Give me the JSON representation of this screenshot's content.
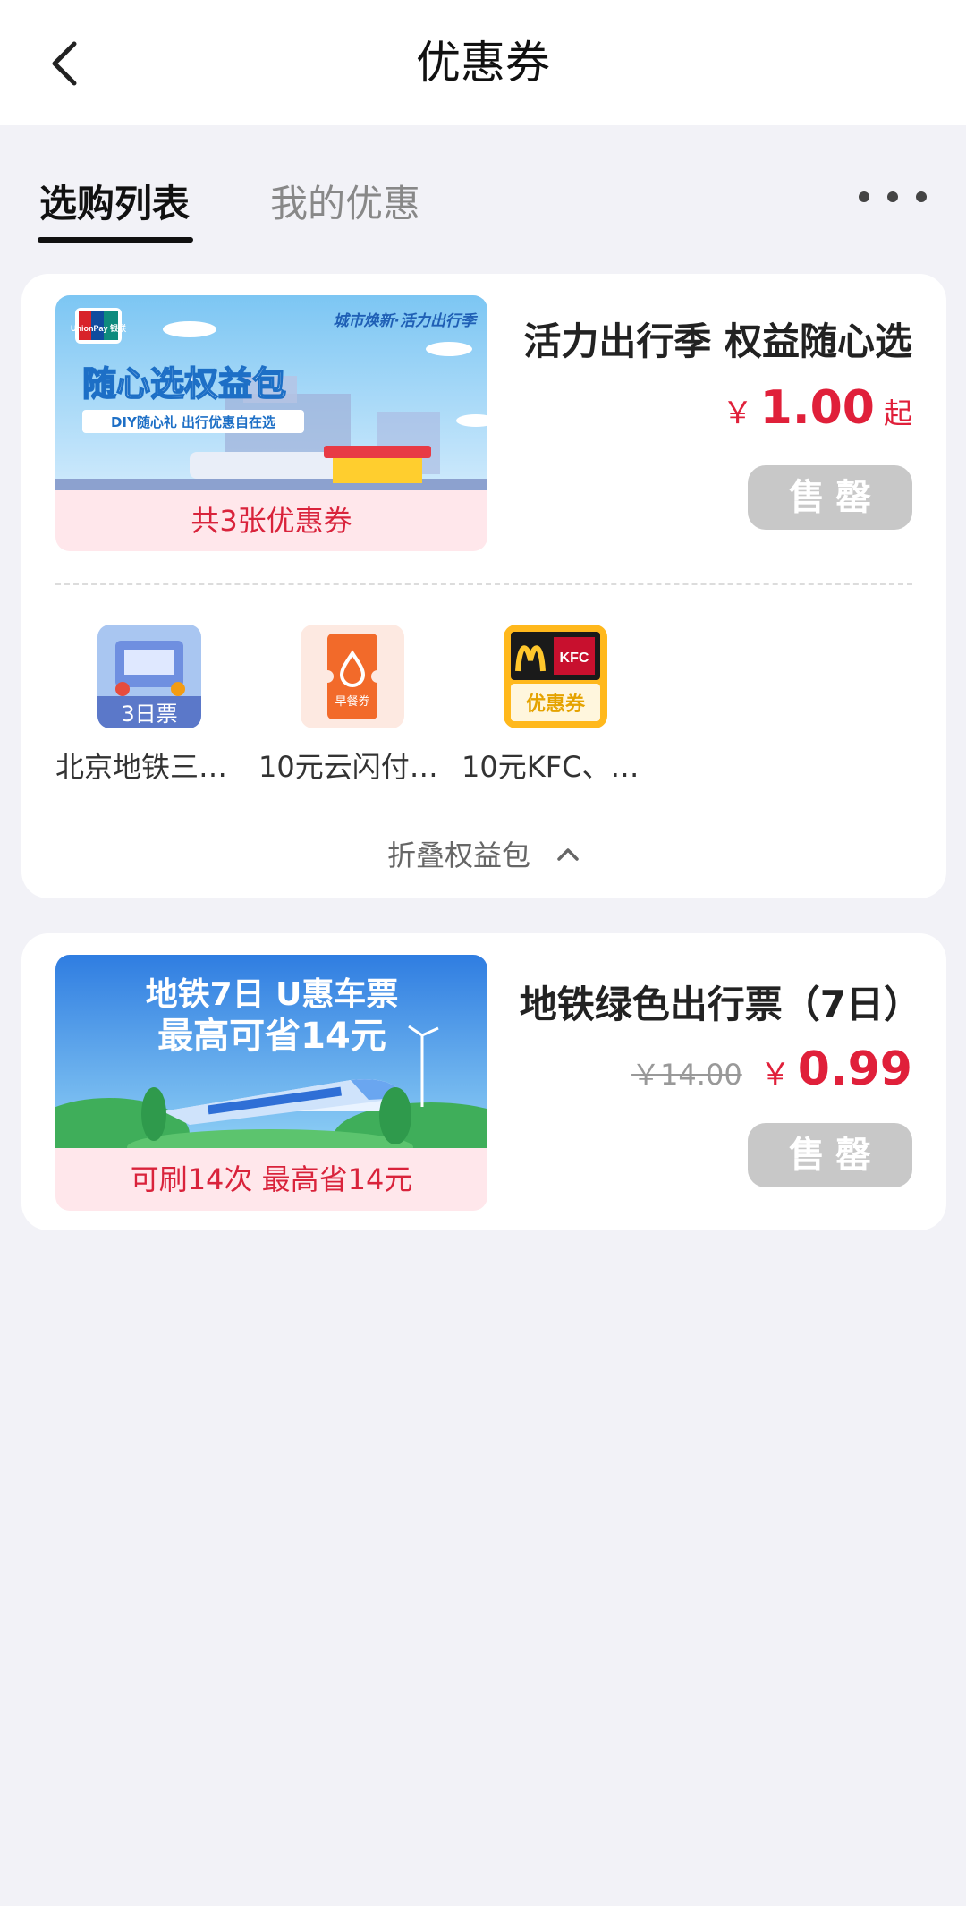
{
  "header": {
    "title": "优惠券"
  },
  "tabs": [
    {
      "label": "选购列表",
      "active": true
    },
    {
      "label": "我的优惠",
      "active": false
    }
  ],
  "products": [
    {
      "title": "活力出行季 权益随心选",
      "banner": {
        "headline": "随心选权益包",
        "sub": "DIY随心礼 出行优惠自在选",
        "tag": "城市焕新·活力出行季",
        "brand": "UnionPay 银联"
      },
      "caption": "共3张优惠券",
      "price": {
        "currency": "￥",
        "amount": "1.00",
        "suffix": "起"
      },
      "button": "售罄",
      "benefits": [
        {
          "icon": "metro-3day-ticket-icon",
          "icon_text": "3日票",
          "label": "北京地铁三…"
        },
        {
          "icon": "breakfast-coupon-icon",
          "icon_text": "早餐券",
          "label": "10元云闪付…"
        },
        {
          "icon": "mcd-kfc-coupon-icon",
          "icon_text": "优惠券",
          "brand_text": "KFC",
          "label": "10元KFC、…"
        }
      ],
      "collapse_label": "折叠权益包"
    },
    {
      "title": "地铁绿色出行票（7日）",
      "banner": {
        "line1": "地铁7日 U惠车票",
        "line2": "最高可省14元"
      },
      "caption": "可刷14次 最高省14元",
      "price": {
        "original": "￥14.00",
        "currency": "￥",
        "amount": "0.99"
      },
      "button": "售罄"
    }
  ],
  "colors": {
    "accent": "#e0203a",
    "sold_out": "#c8c8c8",
    "background": "#f2f2f7"
  }
}
